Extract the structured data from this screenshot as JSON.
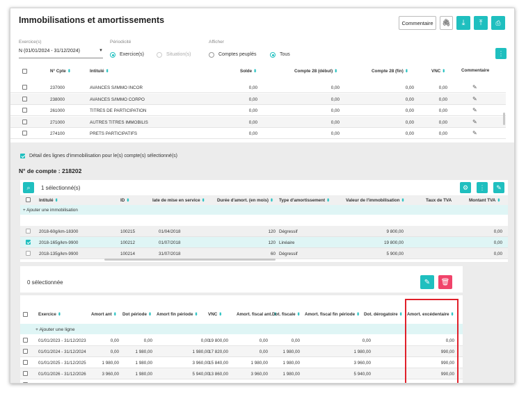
{
  "header": {
    "title": "Immobilisations et amortissements",
    "commentaire_btn": "Commentaire"
  },
  "filters": {
    "exercice_label": "Exercice(s)",
    "exercice_value": "N (01/01/2024 - 31/12/2024)",
    "periodicite_label": "Périodicité",
    "periodicite_options": [
      "Exercice(s)",
      "Situation(s)"
    ],
    "afficher_label": "Afficher",
    "afficher_options": [
      "Comptes peuplés",
      "Tous"
    ]
  },
  "accounts": {
    "headers": [
      "N° Cpte",
      "Intitulé",
      "Solde",
      "Compte 28 (début)",
      "Compte 28 (fin)",
      "VNC",
      "Commentaire"
    ],
    "rows": [
      {
        "num": "237000",
        "label": "AVANCES S/IMMO INCOR",
        "solde": "0,00",
        "c28d": "0,00",
        "c28f": "0,00",
        "vnc": "0,00"
      },
      {
        "num": "238000",
        "label": "AVANCES S/IMMO CORPO",
        "solde": "0,00",
        "c28d": "0,00",
        "c28f": "0,00",
        "vnc": "0,00"
      },
      {
        "num": "261000",
        "label": "TITRES DE PARTICIPATION",
        "solde": "0,00",
        "c28d": "0,00",
        "c28f": "0,00",
        "vnc": "0,00"
      },
      {
        "num": "271000",
        "label": "AUTRES TITRES IMMOBILIS",
        "solde": "0,00",
        "c28d": "0,00",
        "c28f": "0,00",
        "vnc": "0,00"
      },
      {
        "num": "274100",
        "label": "PRETS PARTICIPATIFS",
        "solde": "0,00",
        "c28d": "0,00",
        "c28f": "0,00",
        "vnc": "0,00"
      }
    ]
  },
  "detail": {
    "checkbox_label": "Détail des lignes d'immobilisation pour le(s) compte(s) sélectionné(s)",
    "account_title": "N° de compte : 218202"
  },
  "immos": {
    "selected": "1 sélectionné(s)",
    "add_line": "+ Ajouter une immobilisation",
    "headers": [
      "Intitulé",
      "ID",
      "late de mise en service",
      "Durée d'amort. (en mois)",
      "Type d'amortissement",
      "Valeur de l'immobilisation",
      "Taux de TVA",
      "Montant TVA"
    ],
    "rows": [
      {
        "label": "2018-60g/km-18300",
        "id": "100215",
        "date": "01/04/2018",
        "duree": "120",
        "type": "Dégressif",
        "valeur": "9 800,00",
        "montant": "0,00"
      },
      {
        "label": "2018-165g/km-9900",
        "id": "100212",
        "date": "01/07/2018",
        "duree": "120",
        "type": "Linéaire",
        "valeur": "19 800,00",
        "montant": "0,00"
      },
      {
        "label": "2018-135g/km-9900",
        "id": "100214",
        "date": "31/07/2018",
        "duree": "60",
        "type": "Dégressif",
        "valeur": "5 900,00",
        "montant": "0,00"
      }
    ]
  },
  "exercices": {
    "selected": "0 sélectionnée",
    "add_line": "+ Ajouter une ligne",
    "headers": [
      "Exercice",
      "Amort ant",
      "Dot période",
      "Amort fin période",
      "VNC",
      "Amort. fiscal ant.",
      "Dot. fiscale",
      "Amort. fiscal fin période",
      "Dot. dérogatoire",
      "Amort. excédentaire"
    ],
    "rows": [
      {
        "ex": "01/01/2023 - 31/12/2023",
        "aa": "0,00",
        "dp": "0,00",
        "afp": "0,00",
        "vnc": "19 800,00",
        "afa": "0,00",
        "df": "0,00",
        "affp": "0,00",
        "dd": "",
        "ae": "0,00"
      },
      {
        "ex": "01/01/2024 - 31/12/2024",
        "aa": "0,00",
        "dp": "1 980,00",
        "afp": "1 980,00",
        "vnc": "17 820,00",
        "afa": "0,00",
        "df": "1 980,00",
        "affp": "1 980,00",
        "dd": "",
        "ae": "990,00"
      },
      {
        "ex": "01/01/2025 - 31/12/2025",
        "aa": "1 980,00",
        "dp": "1 980,00",
        "afp": "3 960,00",
        "vnc": "15 840,00",
        "afa": "1 980,00",
        "df": "1 980,00",
        "affp": "3 960,00",
        "dd": "",
        "ae": "990,00"
      },
      {
        "ex": "01/01/2026 - 31/12/2026",
        "aa": "3 960,00",
        "dp": "1 980,00",
        "afp": "5 940,00",
        "vnc": "13 860,00",
        "afa": "3 960,00",
        "df": "1 980,00",
        "affp": "5 940,00",
        "dd": "",
        "ae": "990,00"
      },
      {
        "ex": "01/01/2027 - 31/12/2027",
        "aa": "5 940,00",
        "dp": "1 980,00",
        "afp": "7 920,00",
        "vnc": "11 880,00",
        "afa": "5 940,00",
        "df": "1 980,00",
        "affp": "7 920,00",
        "dd": "",
        "ae": "990,00"
      }
    ]
  },
  "colors": {
    "accent": "#1fbfbf",
    "danger": "#f0436a",
    "highlight": "#e0202a"
  }
}
